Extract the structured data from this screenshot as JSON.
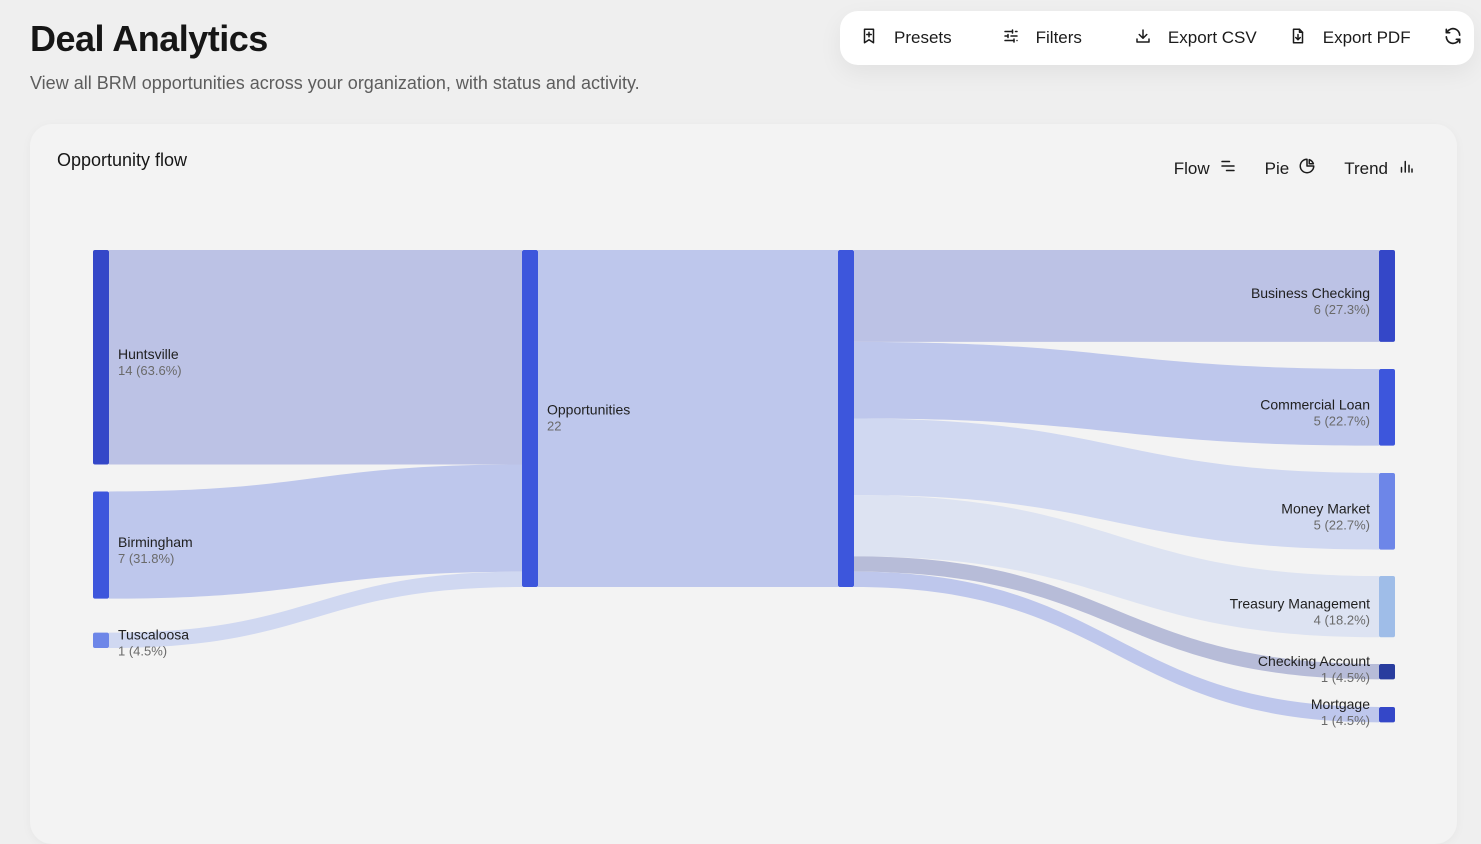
{
  "header": {
    "title": "Deal Analytics",
    "subtitle": "View all BRM opportunities across your organization, with status and activity."
  },
  "toolbar": {
    "presets_label": "Presets",
    "filters_label": "Filters",
    "export_csv_label": "Export CSV",
    "export_pdf_label": "Export PDF",
    "icons": [
      "bookmark-plus-icon",
      "sliders-icon",
      "download-icon",
      "file-download-icon",
      "refresh-icon"
    ]
  },
  "card": {
    "title": "Opportunity flow",
    "views": [
      {
        "label": "Flow",
        "icon": "flow-lines-icon"
      },
      {
        "label": "Pie",
        "icon": "pie-icon"
      },
      {
        "label": "Trend",
        "icon": "bar-chart-icon"
      }
    ]
  },
  "chart_data": {
    "type": "sankey",
    "total": 22,
    "center": {
      "label": "Opportunities",
      "value": "22"
    },
    "sources": [
      {
        "name": "Huntsville",
        "value": 14,
        "label": "14 (63.6%)",
        "color": "#3447c8"
      },
      {
        "name": "Birmingham",
        "value": 7,
        "label": "7 (31.8%)",
        "color": "#3d56dc"
      },
      {
        "name": "Tuscaloosa",
        "value": 1,
        "label": "1 (4.5%)",
        "color": "#6d86e8"
      }
    ],
    "targets": [
      {
        "name": "Business Checking",
        "value": 6,
        "label": "6 (27.3%)",
        "color": "#3447c8"
      },
      {
        "name": "Commercial Loan",
        "value": 5,
        "label": "5 (22.7%)",
        "color": "#3d56dc"
      },
      {
        "name": "Money Market",
        "value": 5,
        "label": "5 (22.7%)",
        "color": "#6d86e8"
      },
      {
        "name": "Treasury Management",
        "value": 4,
        "label": "4 (18.2%)",
        "color": "#9fbde8"
      },
      {
        "name": "Checking Account",
        "value": 1,
        "label": "1 (4.5%)",
        "color": "#283c9e"
      },
      {
        "name": "Mortgage",
        "value": 1,
        "label": "1 (4.5%)",
        "color": "#3447c8"
      }
    ],
    "center_color": "#3d56dc",
    "link_colors": {
      "dark": "#bcc2e5",
      "mid": "#bec7ec",
      "light": "#d0d8f1",
      "lighter": "#dde3f2",
      "gray": "#b7bcd8"
    }
  }
}
